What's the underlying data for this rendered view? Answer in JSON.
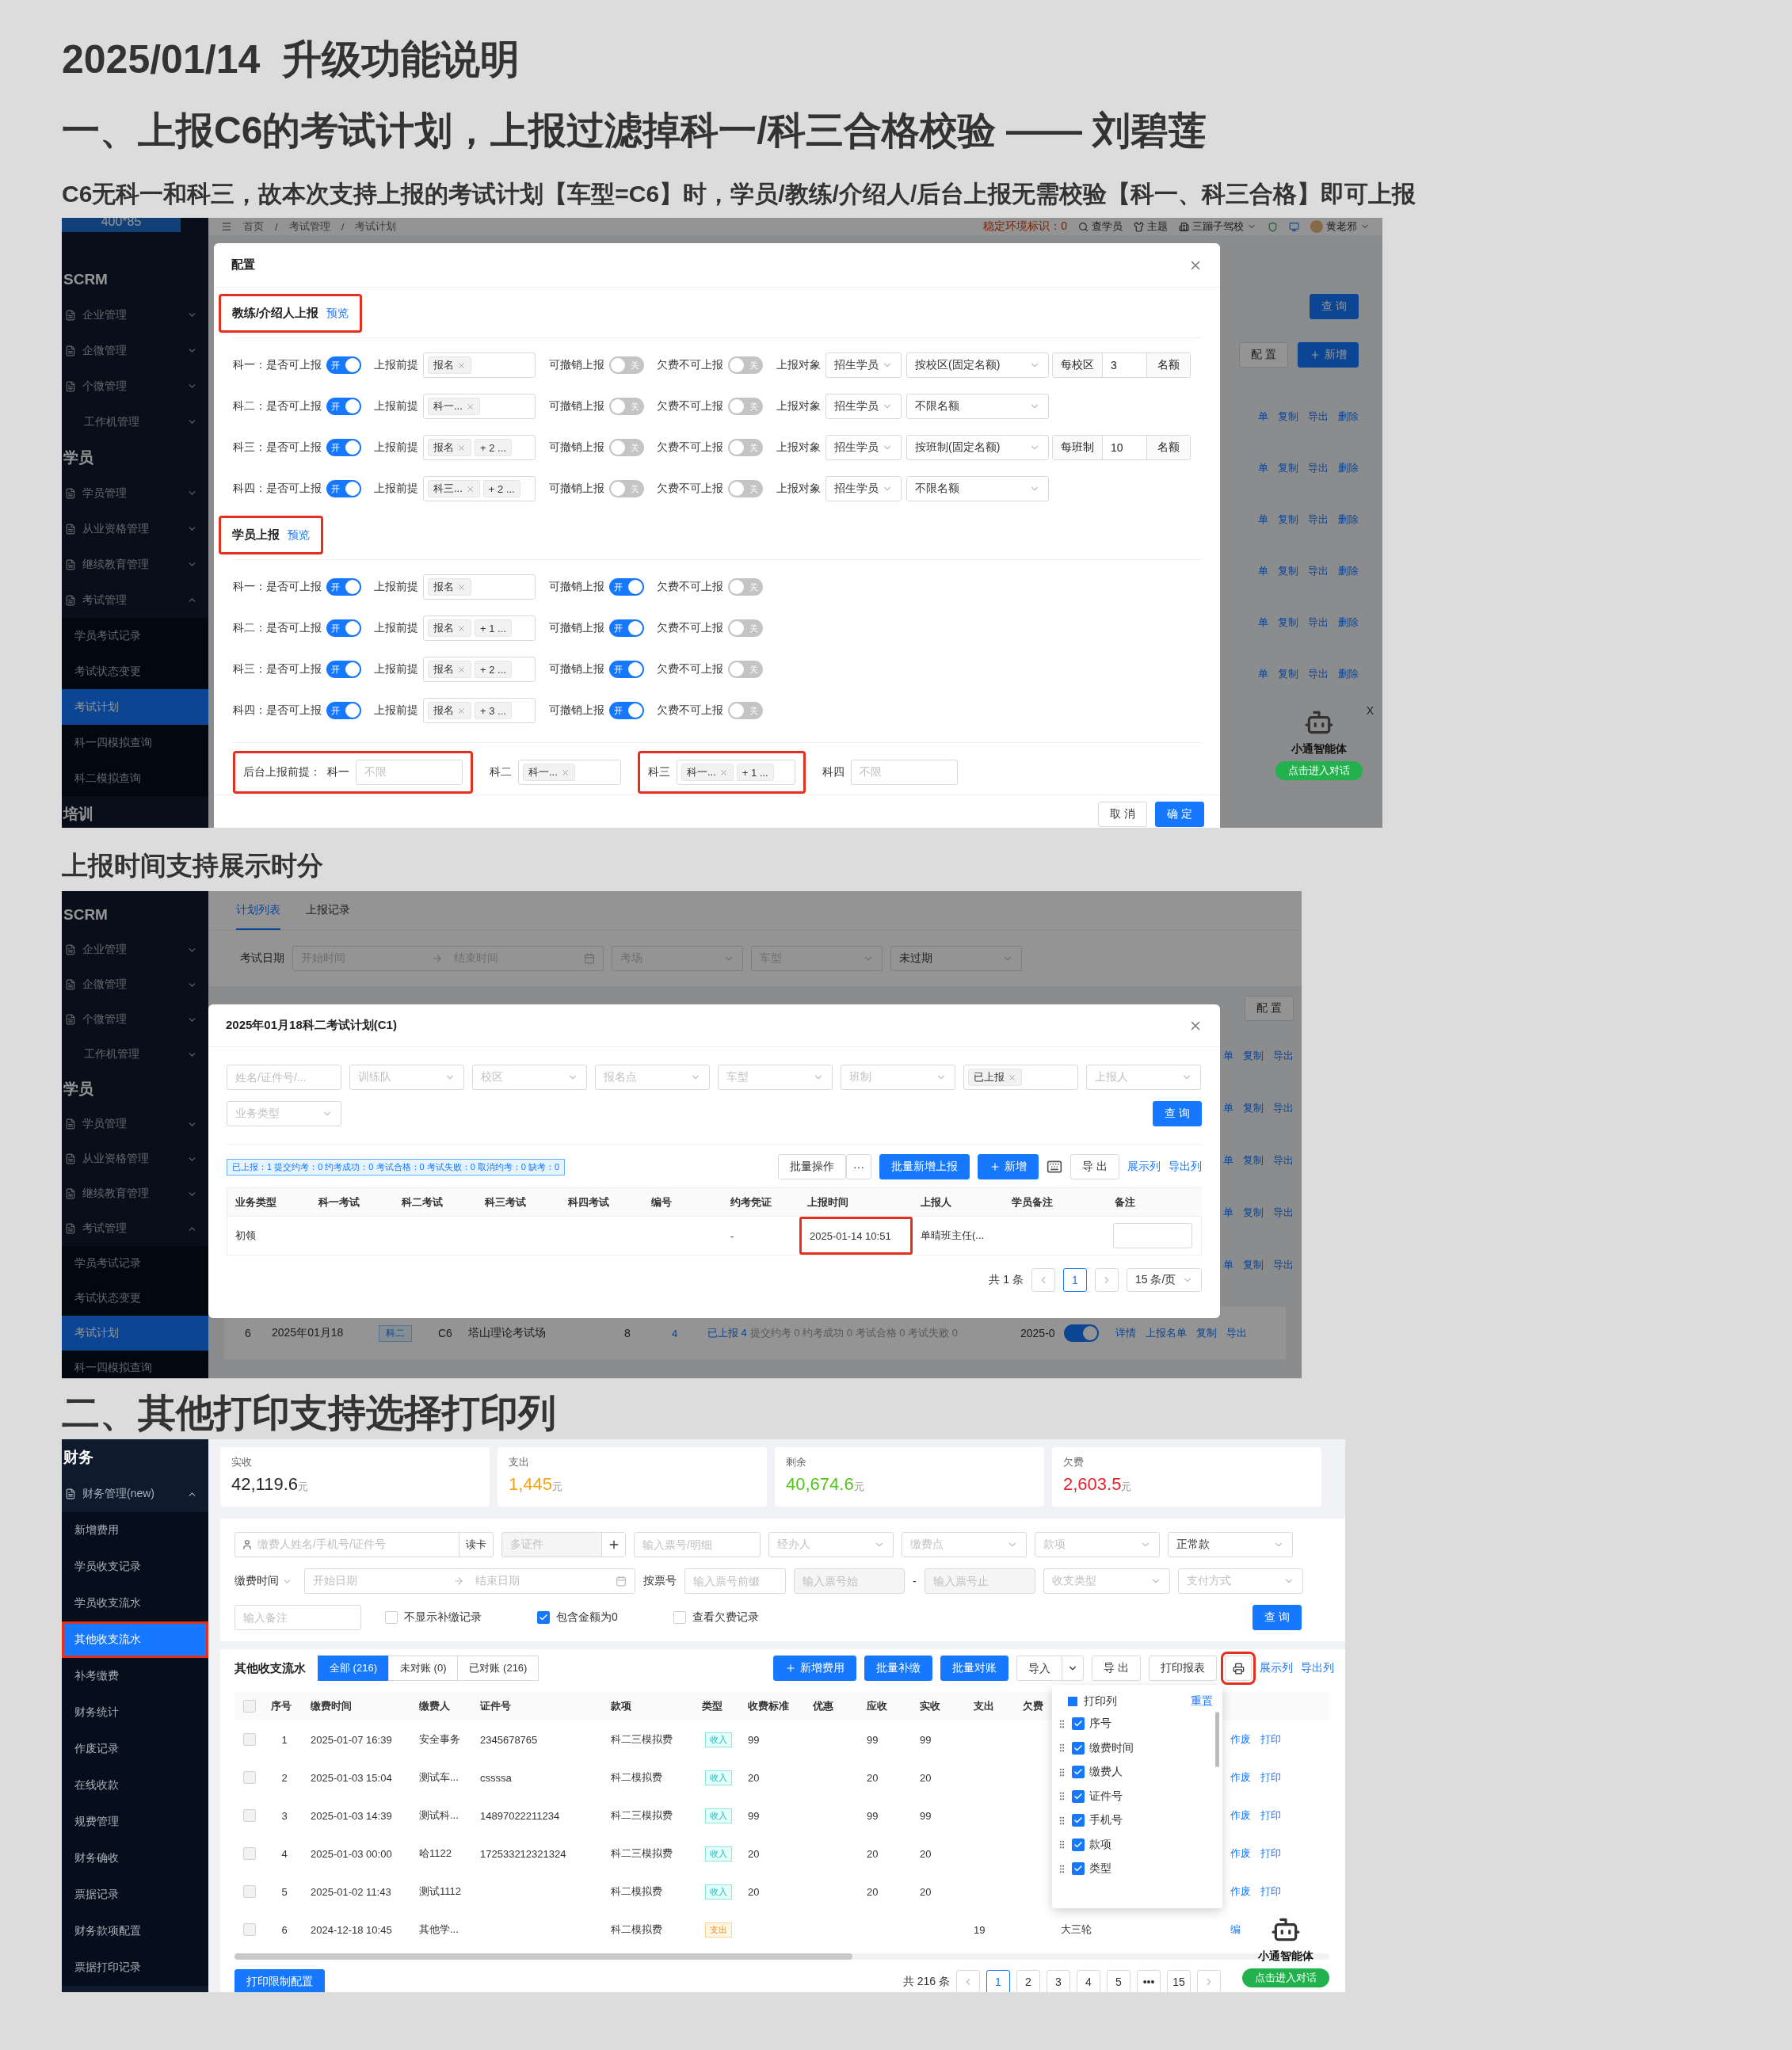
{
  "title": "2025/01/14  升级功能说明",
  "section1": {
    "heading": "一、上报C6的考试计划，上报过滤掉科一/科三合格校验 —— 刘碧莲",
    "description": "C6无科一和科三，故本次支持上报的考试计划【车型=C6】时，学员/教练/介绍人/后台上报无需校验【科一、科三合格】即可上报"
  },
  "shot1": {
    "sidebar": [
      {
        "kind": "badge",
        "label": "400*85"
      },
      {
        "kind": "group",
        "label": "SCRM"
      },
      {
        "kind": "menu",
        "label": "企业管理",
        "expanded": false
      },
      {
        "kind": "menu",
        "label": "企微管理",
        "expanded": false
      },
      {
        "kind": "menu",
        "label": "个微管理",
        "expanded": false
      },
      {
        "kind": "submenu",
        "label": "工作机管理",
        "expanded": false
      },
      {
        "kind": "group",
        "label": "学员"
      },
      {
        "kind": "menu",
        "label": "学员管理",
        "expanded": false
      },
      {
        "kind": "menu",
        "label": "从业资格管理",
        "expanded": false
      },
      {
        "kind": "menu",
        "label": "继续教育管理",
        "expanded": false
      },
      {
        "kind": "menu",
        "label": "考试管理",
        "expanded": true
      },
      {
        "kind": "sub",
        "label": "学员考试记录",
        "selected": false
      },
      {
        "kind": "sub",
        "label": "考试状态变更",
        "selected": false
      },
      {
        "kind": "sub",
        "label": "考试计划",
        "selected": true
      },
      {
        "kind": "sub",
        "label": "科一四模拟查询",
        "selected": false
      },
      {
        "kind": "sub",
        "label": "科二模拟查询",
        "selected": false
      },
      {
        "kind": "group",
        "label": "培训"
      }
    ],
    "breadcrumb": [
      "首页",
      "考试管理",
      "考试计划"
    ],
    "breadcrumb_separator": "/",
    "env_label": "稳定环境标识：0",
    "header_links": [
      "查学员",
      "主题"
    ],
    "school": "三蹦子驾校",
    "user": "黄老邪",
    "query": "查 询",
    "config": "配 置",
    "add": "新增",
    "row_actions": [
      [
        "单",
        "复制",
        "导出",
        "删除"
      ],
      [
        "单",
        "复制",
        "导出",
        "删除"
      ],
      [
        "单",
        "复制",
        "导出",
        "删除"
      ],
      [
        "单",
        "复制",
        "导出",
        "删除"
      ],
      [
        "单",
        "复制",
        "导出",
        "删除"
      ],
      [
        "单",
        "复制",
        "导出",
        "删除"
      ]
    ],
    "modal": {
      "title": "配置",
      "sections": [
        {
          "title": "教练/介绍人上报",
          "link": "预览",
          "highlighted": true,
          "rows": [
            {
              "label": "科一：是否可上报",
              "enabled": {
                "on": true,
                "text": "开"
              },
              "condition_label": "上报前提",
              "tags": [
                {
                  "text": "报名",
                  "closable": true
                }
              ],
              "revoke": {
                "label": "可撤销上报",
                "on": false,
                "text": "关"
              },
              "arrears": {
                "label": "欠费不可上报",
                "on": false,
                "text": "关"
              },
              "target": {
                "label": "上报对象",
                "selects": [
                  "招生学员",
                  "按校区(固定名额)"
                ]
              },
              "quota": {
                "prefix": "每校区",
                "value": "3",
                "suffix": "名额"
              }
            },
            {
              "label": "科二：是否可上报",
              "enabled": {
                "on": true,
                "text": "开"
              },
              "condition_label": "上报前提",
              "tags": [
                {
                  "text": "科一...",
                  "closable": true
                }
              ],
              "revoke": {
                "label": "可撤销上报",
                "on": false,
                "text": "关"
              },
              "arrears": {
                "label": "欠费不可上报",
                "on": false,
                "text": "关"
              },
              "target": {
                "label": "上报对象",
                "selects": [
                  "招生学员",
                  "不限名额"
                ]
              }
            },
            {
              "label": "科三：是否可上报",
              "enabled": {
                "on": true,
                "text": "开"
              },
              "condition_label": "上报前提",
              "tags": [
                {
                  "text": "报名",
                  "closable": true
                },
                {
                  "text": "+ 2 ...",
                  "closable": false
                }
              ],
              "revoke": {
                "label": "可撤销上报",
                "on": false,
                "text": "关"
              },
              "arrears": {
                "label": "欠费不可上报",
                "on": false,
                "text": "关"
              },
              "target": {
                "label": "上报对象",
                "selects": [
                  "招生学员",
                  "按班制(固定名额)"
                ]
              },
              "quota": {
                "prefix": "每班制",
                "value": "10",
                "suffix": "名额"
              }
            },
            {
              "label": "科四：是否可上报",
              "enabled": {
                "on": true,
                "text": "开"
              },
              "condition_label": "上报前提",
              "tags": [
                {
                  "text": "科三...",
                  "closable": true
                },
                {
                  "text": "+ 2 ...",
                  "closable": false
                }
              ],
              "revoke": {
                "label": "可撤销上报",
                "on": false,
                "text": "关"
              },
              "arrears": {
                "label": "欠费不可上报",
                "on": false,
                "text": "关"
              },
              "target": {
                "label": "上报对象",
                "selects": [
                  "招生学员",
                  "不限名额"
                ]
              }
            }
          ]
        },
        {
          "title": "学员上报",
          "link": "预览",
          "highlighted": true,
          "rows": [
            {
              "label": "科一：是否可上报",
              "enabled": {
                "on": true,
                "text": "开"
              },
              "condition_label": "上报前提",
              "tags": [
                {
                  "text": "报名",
                  "closable": true
                }
              ],
              "revoke": {
                "label": "可撤销上报",
                "on": true,
                "text": "开"
              },
              "arrears": {
                "label": "欠费不可上报",
                "on": false,
                "text": "关"
              }
            },
            {
              "label": "科二：是否可上报",
              "enabled": {
                "on": true,
                "text": "开"
              },
              "condition_label": "上报前提",
              "tags": [
                {
                  "text": "报名",
                  "closable": true
                },
                {
                  "text": "+ 1 ...",
                  "closable": false
                }
              ],
              "revoke": {
                "label": "可撤销上报",
                "on": true,
                "text": "开"
              },
              "arrears": {
                "label": "欠费不可上报",
                "on": false,
                "text": "关"
              }
            },
            {
              "label": "科三：是否可上报",
              "enabled": {
                "on": true,
                "text": "开"
              },
              "condition_label": "上报前提",
              "tags": [
                {
                  "text": "报名",
                  "closable": true
                },
                {
                  "text": "+ 2 ...",
                  "closable": false
                }
              ],
              "revoke": {
                "label": "可撤销上报",
                "on": true,
                "text": "开"
              },
              "arrears": {
                "label": "欠费不可上报",
                "on": false,
                "text": "关"
              }
            },
            {
              "label": "科四：是否可上报",
              "enabled": {
                "on": true,
                "text": "开"
              },
              "condition_label": "上报前提",
              "tags": [
                {
                  "text": "报名",
                  "closable": true
                },
                {
                  "text": "+ 3 ...",
                  "closable": false
                }
              ],
              "revoke": {
                "label": "可撤销上报",
                "on": true,
                "text": "开"
              },
              "arrears": {
                "label": "欠费不可上报",
                "on": false,
                "text": "关"
              }
            }
          ]
        }
      ],
      "backend": [
        {
          "highlighted": true,
          "label": "后台上报前提：",
          "item": {
            "label": "科一",
            "placeholder": "不限"
          }
        },
        {
          "item": {
            "label": "科二",
            "tags": [
              {
                "text": "科一...",
                "closable": true
              }
            ]
          }
        },
        {
          "highlighted": true,
          "item": {
            "label": "科三",
            "tags": [
              {
                "text": "科一...",
                "closable": true
              },
              {
                "text": "+ 1 ...",
                "closable": false
              }
            ]
          }
        },
        {
          "item": {
            "label": "科四",
            "placeholder": "不限"
          }
        }
      ],
      "buttons": [
        {
          "kind": "default",
          "label": "取 消"
        },
        {
          "kind": "primary",
          "label": "确 定"
        }
      ]
    },
    "assistant": {
      "close": "X",
      "name": "小通智能体",
      "action": "点击进入对话"
    }
  },
  "subheading": "上报时间支持展示时分",
  "shot2": {
    "sidebar": [
      {
        "kind": "group",
        "label": "SCRM"
      },
      {
        "kind": "menu",
        "label": "企业管理",
        "expanded": false
      },
      {
        "kind": "menu",
        "label": "企微管理",
        "expanded": false
      },
      {
        "kind": "menu",
        "label": "个微管理",
        "expanded": false
      },
      {
        "kind": "submenu",
        "label": "工作机管理",
        "expanded": false
      },
      {
        "kind": "group",
        "label": "学员"
      },
      {
        "kind": "menu",
        "label": "学员管理",
        "expanded": false
      },
      {
        "kind": "menu",
        "label": "从业资格管理",
        "expanded": false
      },
      {
        "kind": "menu",
        "label": "继续教育管理",
        "expanded": false
      },
      {
        "kind": "menu",
        "label": "考试管理",
        "expanded": true
      },
      {
        "kind": "sub",
        "label": "学员考试记录",
        "selected": false
      },
      {
        "kind": "sub",
        "label": "考试状态变更",
        "selected": false
      },
      {
        "kind": "sub",
        "label": "考试计划",
        "selected": true
      },
      {
        "kind": "sub",
        "label": "科一四模拟查询",
        "selected": false
      }
    ],
    "tabs": [
      {
        "label": "计划列表",
        "selected": true
      },
      {
        "label": "上报记录",
        "selected": false
      }
    ],
    "filter": {
      "label": "考试日期",
      "start": "开始时间",
      "end": "结束时间",
      "selects": [
        {
          "placeholder": "考场"
        },
        {
          "placeholder": "车型"
        },
        {
          "value": "未过期"
        }
      ]
    },
    "config": "配 置",
    "row_actions": [
      [
        "单",
        "复制",
        "导出"
      ],
      [
        "单",
        "复制",
        "导出"
      ],
      [
        "单",
        "复制",
        "导出"
      ],
      [
        "单",
        "复制",
        "导出"
      ],
      [
        "单",
        "复制",
        "导出"
      ]
    ],
    "bg_row": {
      "no": "6",
      "date": "2025年01月18",
      "subject": "科二",
      "car": "C6",
      "site": "塔山理论考试场",
      "count": "8",
      "link": "4",
      "status_link": "已上报 4",
      "status": "提交约考 0   约考成功 0   考试合格 0   考试失败 0",
      "time": "2025-0",
      "on": true,
      "actions": [
        "详情",
        "上报名单",
        "复制",
        "导出"
      ]
    },
    "modal": {
      "title": "2025年01月18科二考试计划(C1)",
      "filters": [
        {
          "kind": "input",
          "placeholder": "姓名/证件号/..."
        },
        {
          "kind": "select",
          "placeholder": "训练队"
        },
        {
          "kind": "select",
          "placeholder": "校区"
        },
        {
          "kind": "select",
          "placeholder": "报名点"
        },
        {
          "kind": "select",
          "placeholder": "车型"
        },
        {
          "kind": "select",
          "placeholder": "班制"
        },
        {
          "kind": "tags",
          "tags": [
            {
              "text": "已上报",
              "closable": true
            }
          ]
        },
        {
          "kind": "select",
          "placeholder": "上报人"
        },
        {
          "kind": "select",
          "placeholder": "业务类型"
        }
      ],
      "query": "查 询",
      "stats": "已上报：1  提交约考：0  约考成功：0  考试合格：0  考试失败：0  取消约考：0  缺考：0",
      "batch": "批量操作",
      "more": "···",
      "batch_add": "批量新增上报",
      "add": "新增",
      "export": "导 出",
      "links": [
        "展示列",
        "导出列"
      ],
      "columns": [
        "业务类型",
        "科一考试",
        "科二考试",
        "科三考试",
        "科四考试",
        "编号",
        "约考凭证",
        "上报时间",
        "上报人",
        "学员备注",
        "备注"
      ],
      "rows": [
        {
          "cells": [
            {
              "text": "初领"
            },
            {},
            {},
            {},
            {},
            {},
            {
              "text": "-"
            },
            {
              "text": "2025-01-14 10:51",
              "highlighted": true
            },
            {
              "text": "单晴班主任(..."
            },
            {},
            {
              "kind": "input"
            }
          ]
        }
      ],
      "total": "共 1 条",
      "pages": [
        {
          "label": "1",
          "selected": true
        }
      ],
      "page_size": "15 条/页"
    }
  },
  "section2": {
    "heading": "二、其他打印支持选择打印列"
  },
  "shot3": {
    "sidebar": [
      {
        "kind": "group",
        "label": "财务"
      },
      {
        "kind": "menu",
        "label": "财务管理(new)",
        "expanded": true
      },
      {
        "kind": "sub",
        "label": "新增费用",
        "selected": false
      },
      {
        "kind": "sub",
        "label": "学员收支记录",
        "selected": false
      },
      {
        "kind": "sub",
        "label": "学员收支流水",
        "selected": false
      },
      {
        "kind": "sub",
        "label": "其他收支流水",
        "selected": true,
        "highlighted": true
      },
      {
        "kind": "sub",
        "label": "补考缴费",
        "selected": false
      },
      {
        "kind": "sub",
        "label": "财务统计",
        "selected": false
      },
      {
        "kind": "sub",
        "label": "作废记录",
        "selected": false
      },
      {
        "kind": "sub",
        "label": "在线收款",
        "selected": false
      },
      {
        "kind": "sub",
        "label": "规费管理",
        "selected": false
      },
      {
        "kind": "sub",
        "label": "财务确收",
        "selected": false
      },
      {
        "kind": "sub",
        "label": "票据记录",
        "selected": false
      },
      {
        "kind": "sub",
        "label": "财务款项配置",
        "selected": false
      },
      {
        "kind": "sub",
        "label": "票据打印记录",
        "selected": false
      }
    ],
    "cards": [
      {
        "label": "实收",
        "value": "42,119.6",
        "unit": "元",
        "color": "#262626"
      },
      {
        "label": "支出",
        "value": "1,445",
        "unit": "元",
        "color": "#f2a516"
      },
      {
        "label": "剩余",
        "value": "40,674.6",
        "unit": "元",
        "color": "#52c41a"
      },
      {
        "label": "欠费",
        "value": "2,603.5",
        "unit": "元",
        "color": "#e5212d"
      }
    ],
    "filter_rows": [
      [
        {
          "kind": "search",
          "placeholder": "缴费人姓名/手机号/证件号",
          "button": "读卡"
        },
        {
          "kind": "multi",
          "placeholder": "多证件"
        },
        {
          "kind": "input",
          "placeholder": "输入票号/明细"
        },
        {
          "kind": "select",
          "placeholder": "经办人"
        },
        {
          "kind": "select",
          "placeholder": "缴费点"
        },
        {
          "kind": "select",
          "placeholder": "款项"
        },
        {
          "kind": "select",
          "value": "正常款"
        }
      ],
      [
        {
          "kind": "label_select",
          "label": "缴费时间"
        },
        {
          "kind": "range",
          "start": "开始日期",
          "end": "结束日期"
        },
        {
          "kind": "label",
          "label": "按票号"
        },
        {
          "kind": "input",
          "placeholder": "输入票号前缀"
        },
        {
          "kind": "disabled",
          "placeholder": "输入票号始"
        },
        {
          "kind": "label",
          "label": "-"
        },
        {
          "kind": "disabled",
          "placeholder": "输入票号止"
        },
        {
          "kind": "select",
          "placeholder": "收支类型"
        },
        {
          "kind": "select",
          "placeholder": "支付方式"
        }
      ],
      [
        {
          "kind": "input",
          "placeholder": "输入备注"
        },
        {
          "kind": "checkbox",
          "label": "不显示补缴记录",
          "checked": false
        },
        {
          "kind": "checkbox",
          "label": "包含金额为0",
          "checked": true
        },
        {
          "kind": "checkbox",
          "label": "查看欠费记录",
          "checked": false
        },
        {
          "kind": "button",
          "label": "查 询"
        }
      ]
    ],
    "list_title": "其他收支流水",
    "tabs": [
      {
        "label": "全部 (216)",
        "selected": true
      },
      {
        "label": "未对账 (0)",
        "selected": false
      },
      {
        "label": "已对账 (216)",
        "selected": false
      }
    ],
    "buttons": [
      {
        "kind": "primary_add",
        "label": "新增费用"
      },
      {
        "kind": "primary",
        "label": "批量补缴"
      },
      {
        "kind": "primary",
        "label": "批量对账"
      },
      {
        "kind": "split",
        "label": "导入"
      },
      {
        "kind": "default",
        "label": "导 出"
      },
      {
        "kind": "default",
        "label": "打印报表"
      },
      {
        "kind": "print",
        "highlighted": true
      },
      {
        "kind": "link",
        "label": "展示列"
      },
      {
        "kind": "link",
        "label": "导出列"
      }
    ],
    "all_checked": false,
    "columns": [
      "序号",
      "缴费时间",
      "缴费人",
      "证件号",
      "款项",
      "类型",
      "收费标准",
      "优惠",
      "应收",
      "实收",
      "支出",
      "欠费"
    ],
    "rows": [
      {
        "checked": false,
        "no": "1",
        "time": "2025-01-07 16:39",
        "payer": "安全事务",
        "id_no": "2345678765",
        "item": "科二三模拟费",
        "type": {
          "label": "收入",
          "kind": "income"
        },
        "standard": "99",
        "receivable": "99",
        "received": "99",
        "actions": [
          "作废",
          "打印"
        ]
      },
      {
        "checked": false,
        "no": "2",
        "time": "2025-01-03 15:04",
        "payer": "测试车...",
        "id_no": "cssssa",
        "item": "科二模拟费",
        "type": {
          "label": "收入",
          "kind": "income"
        },
        "standard": "20",
        "receivable": "20",
        "received": "20",
        "actions": [
          "作废",
          "打印"
        ]
      },
      {
        "checked": false,
        "no": "3",
        "time": "2025-01-03 14:39",
        "payer": "测试科...",
        "id_no": "14897022211234",
        "item": "科二三模拟费",
        "type": {
          "label": "收入",
          "kind": "income"
        },
        "standard": "99",
        "receivable": "99",
        "received": "99",
        "actions": [
          "作废",
          "打印"
        ]
      },
      {
        "checked": false,
        "no": "4",
        "time": "2025-01-03 00:00",
        "payer": "哈1122",
        "id_no": "172533212321324",
        "item": "科二三模拟费",
        "type": {
          "label": "收入",
          "kind": "income"
        },
        "standard": "20",
        "receivable": "20",
        "received": "20",
        "actions": [
          "作废",
          "打印"
        ]
      },
      {
        "checked": false,
        "no": "5",
        "time": "2025-01-02 11:43",
        "payer": "测试1112",
        "item": "科二模拟费",
        "type": {
          "label": "收入",
          "kind": "income"
        },
        "standard": "20",
        "receivable": "20",
        "received": "20",
        "actions": [
          "作废",
          "打印"
        ]
      },
      {
        "checked": false,
        "no": "6",
        "time": "2024-12-18 10:45",
        "payer": "其他学...",
        "item": "科二模拟费",
        "type": {
          "label": "支出",
          "kind": "expense"
        },
        "expense": "19",
        "note": "大三轮",
        "actions": [
          "编"
        ]
      }
    ],
    "print_columns": {
      "label": "打印列",
      "indeterminate": true,
      "reset": "重置",
      "items": [
        {
          "label": "序号",
          "checked": true
        },
        {
          "label": "缴费时间",
          "checked": true
        },
        {
          "label": "缴费人",
          "checked": true
        },
        {
          "label": "证件号",
          "checked": true
        },
        {
          "label": "手机号",
          "checked": true
        },
        {
          "label": "款项",
          "checked": true
        },
        {
          "label": "类型",
          "checked": true
        }
      ]
    },
    "print_config": "打印限制配置",
    "total": "共 216 条",
    "pages": [
      {
        "label": "1",
        "selected": true
      },
      {
        "label": "2",
        "selected": false
      },
      {
        "label": "3",
        "selected": false
      },
      {
        "label": "4",
        "selected": false
      },
      {
        "label": "5",
        "selected": false
      },
      {
        "label": "•••",
        "selected": false
      },
      {
        "label": "15",
        "selected": false
      }
    ],
    "assistant": {
      "name": "小通智能体",
      "action": "点击进入对话"
    }
  }
}
